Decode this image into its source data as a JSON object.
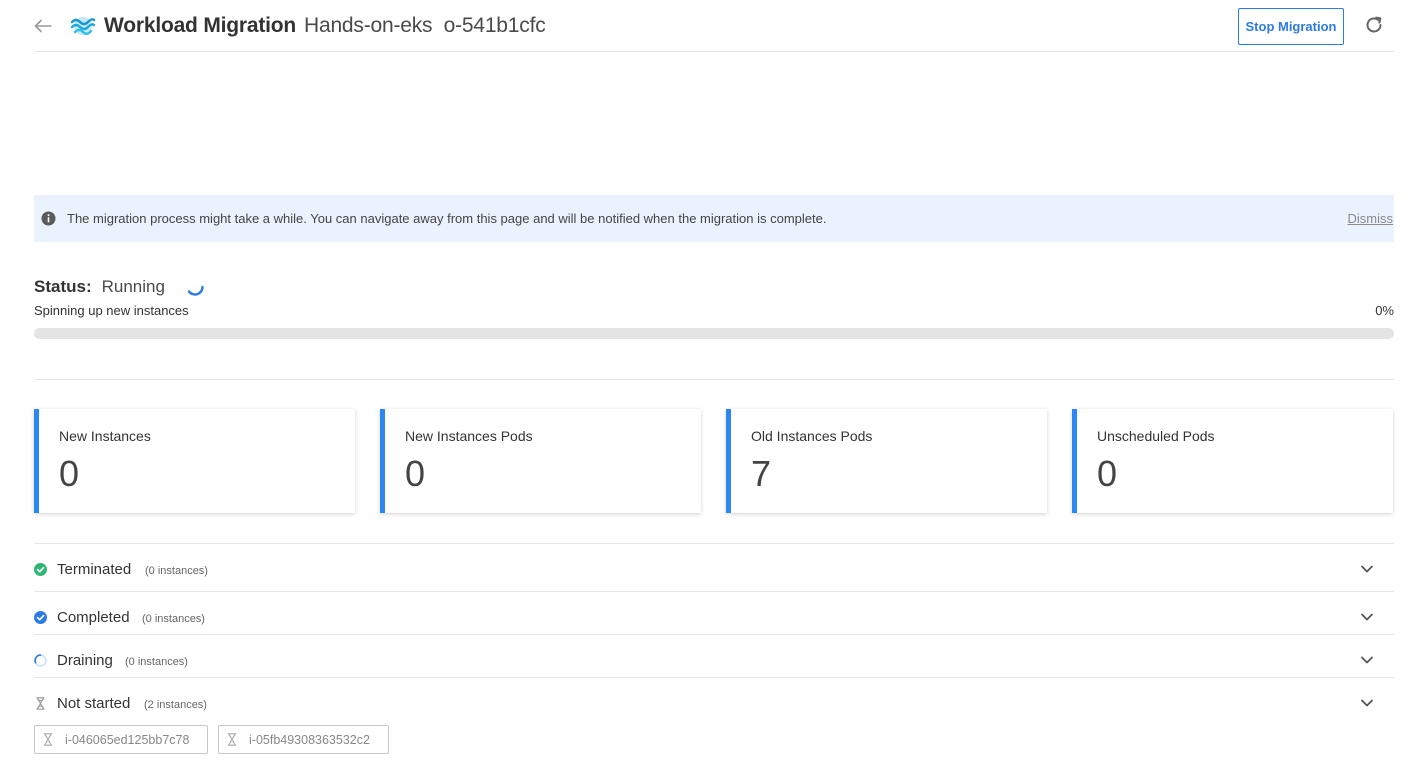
{
  "header": {
    "title": "Workload Migration",
    "subtitle": "Hands-on-eks  o-541b1cfc",
    "stop_label": "Stop Migration",
    "icons": {
      "back": "arrow-left-icon",
      "logo": "waves-logo-icon",
      "refresh": "refresh-icon"
    }
  },
  "banner": {
    "message": "The migration process might take a while. You can navigate away from this page and will be notified when the migration is complete.",
    "dismiss_label": "Dismiss"
  },
  "status": {
    "label": "Status:",
    "value": "Running",
    "phase": "Spinning up new instances",
    "progress_percent_label": "0%",
    "progress_fraction": 0
  },
  "cards": [
    {
      "label": "New Instances",
      "value": "0"
    },
    {
      "label": "New Instances Pods",
      "value": "0"
    },
    {
      "label": "Old Instances Pods",
      "value": "7"
    },
    {
      "label": "Unscheduled Pods",
      "value": "0"
    }
  ],
  "groups": [
    {
      "title": "Terminated",
      "count": "(0 instances)",
      "icon": "check-circle-green-icon"
    },
    {
      "title": "Completed",
      "count": "(0 instances)",
      "icon": "check-circle-blue-icon"
    },
    {
      "title": "Draining",
      "count": "(0 instances)",
      "icon": "draining-spinner-icon"
    },
    {
      "title": "Not started",
      "count": "(2 instances)",
      "icon": "hourglass-icon"
    }
  ],
  "instances": [
    {
      "id": "i-046065ed125bb7c78"
    },
    {
      "id": "i-05fb49308363532c2"
    }
  ],
  "colors": {
    "accent": "#2d7be5",
    "card_bar": "#2d87f0",
    "terminated": "#2fb574",
    "completed": "#2d7be5",
    "banner_bg": "#e9f2fd"
  }
}
